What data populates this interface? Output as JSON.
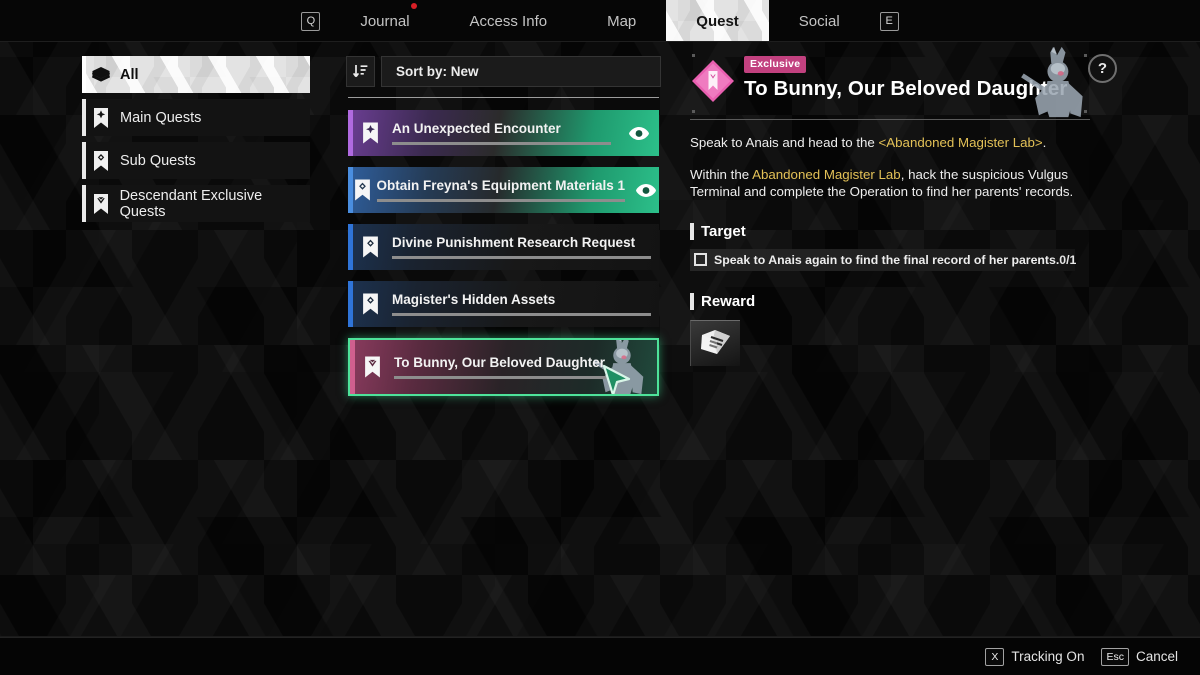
{
  "nav": {
    "left_key": "Q",
    "right_key": "E",
    "tabs": [
      {
        "label": "Journal",
        "active": false
      },
      {
        "label": "Access Info",
        "active": false
      },
      {
        "label": "Map",
        "active": false
      },
      {
        "label": "Quest",
        "active": true
      },
      {
        "label": "Social",
        "active": false
      }
    ],
    "notification_dot": true
  },
  "sidebar": {
    "items": [
      {
        "label": "All",
        "icon": "layers-icon",
        "selected": true
      },
      {
        "label": "Main Quests",
        "icon": "bookmark-cross-icon",
        "selected": false
      },
      {
        "label": "Sub Quests",
        "icon": "bookmark-diamond-icon",
        "selected": false
      },
      {
        "label": "Descendant Exclusive Quests",
        "icon": "bookmark-crown-icon",
        "selected": false
      }
    ]
  },
  "sort": {
    "icon": "sort-descending-icon",
    "label": "Sort by: New"
  },
  "quest_list": [
    {
      "name": "An Unexpected Encounter",
      "icon": "bookmark-cross-icon",
      "accent": "#a05bd6",
      "tracking": true,
      "selected": false,
      "progress": 100
    },
    {
      "name": "Obtain Freyna's Equipment Materials 1",
      "icon": "bookmark-diamond-icon",
      "accent": "#3d7fd4",
      "tracking": true,
      "selected": false,
      "progress": 100
    },
    {
      "name": "Divine Punishment Research Request",
      "icon": "bookmark-diamond-icon",
      "accent": "#2f6fd0",
      "tracking": false,
      "selected": false,
      "progress": 100
    },
    {
      "name": "Magister's Hidden Assets",
      "icon": "bookmark-diamond-icon",
      "accent": "#2f6fd0",
      "tracking": false,
      "selected": false,
      "progress": 100
    },
    {
      "name": "To Bunny, Our Beloved Daughter",
      "icon": "bookmark-crown-icon",
      "accent": "#c2527f",
      "tracking": false,
      "selected": true,
      "progress": 100
    }
  ],
  "detail": {
    "badge": "Exclusive",
    "title": "To Bunny, Our Beloved Daughter",
    "icon": "diamond-bookmark-icon",
    "help_label": "?",
    "description": [
      {
        "parts": [
          {
            "text": "Speak to Anais and head to the ",
            "highlight": false
          },
          {
            "text": "<Abandoned Magister Lab>",
            "highlight": true
          },
          {
            "text": ".",
            "highlight": false
          }
        ]
      },
      {
        "parts": [
          {
            "text": "Within the ",
            "highlight": false
          },
          {
            "text": "Abandoned Magister Lab",
            "highlight": true
          },
          {
            "text": ", hack the suspicious Vulgus Terminal and complete the Operation to find her parents' records.",
            "highlight": false
          }
        ]
      }
    ],
    "target": {
      "section_label": "Target",
      "text": "Speak to Anais again to find the final record of her parents.",
      "count": "0/1",
      "checked": false
    },
    "reward": {
      "section_label": "Reward",
      "items": [
        {
          "icon": "book-icon"
        }
      ]
    }
  },
  "bottom_bar": {
    "hints": [
      {
        "key": "X",
        "label": "Tracking On"
      },
      {
        "key": "Esc",
        "label": "Cancel"
      }
    ]
  },
  "colors": {
    "accent_green": "#4ee39a",
    "highlight_gold": "#e3c157",
    "badge_pink": "#c2417f",
    "notification_red": "#d81f26"
  }
}
